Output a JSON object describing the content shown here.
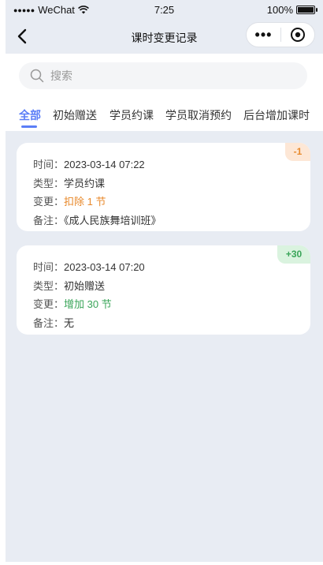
{
  "status_bar": {
    "signal_dots": "●●●●●",
    "carrier": "WeChat",
    "time": "7:25",
    "battery": "100%"
  },
  "nav": {
    "title": "课时变更记录",
    "more_label": "•••"
  },
  "search": {
    "placeholder": "搜索"
  },
  "tabs": [
    {
      "label": "全部",
      "active": true
    },
    {
      "label": "初始赠送",
      "active": false
    },
    {
      "label": "学员约课",
      "active": false
    },
    {
      "label": "学员取消预约",
      "active": false
    },
    {
      "label": "后台增加课时",
      "active": false
    }
  ],
  "records": [
    {
      "badge": "-1",
      "badge_kind": "minus",
      "time_label": "时间：",
      "time": "2023-03-14 07:22",
      "type_label": "类型：",
      "type": "学员约课",
      "change_label": "变更：",
      "change": "扣除 1 节",
      "note_label": "备注：",
      "note": "《成人民族舞培训班》"
    },
    {
      "badge": "+30",
      "badge_kind": "plus",
      "time_label": "时间：",
      "time": "2023-03-14 07:20",
      "type_label": "类型：",
      "type": "初始赠送",
      "change_label": "变更：",
      "change": "增加 30 节",
      "note_label": "备注：",
      "note": "无"
    }
  ],
  "colors": {
    "accent": "#5b7ef7",
    "minus": "#e8892b",
    "plus": "#3aa559",
    "background": "#e8ecf3"
  }
}
